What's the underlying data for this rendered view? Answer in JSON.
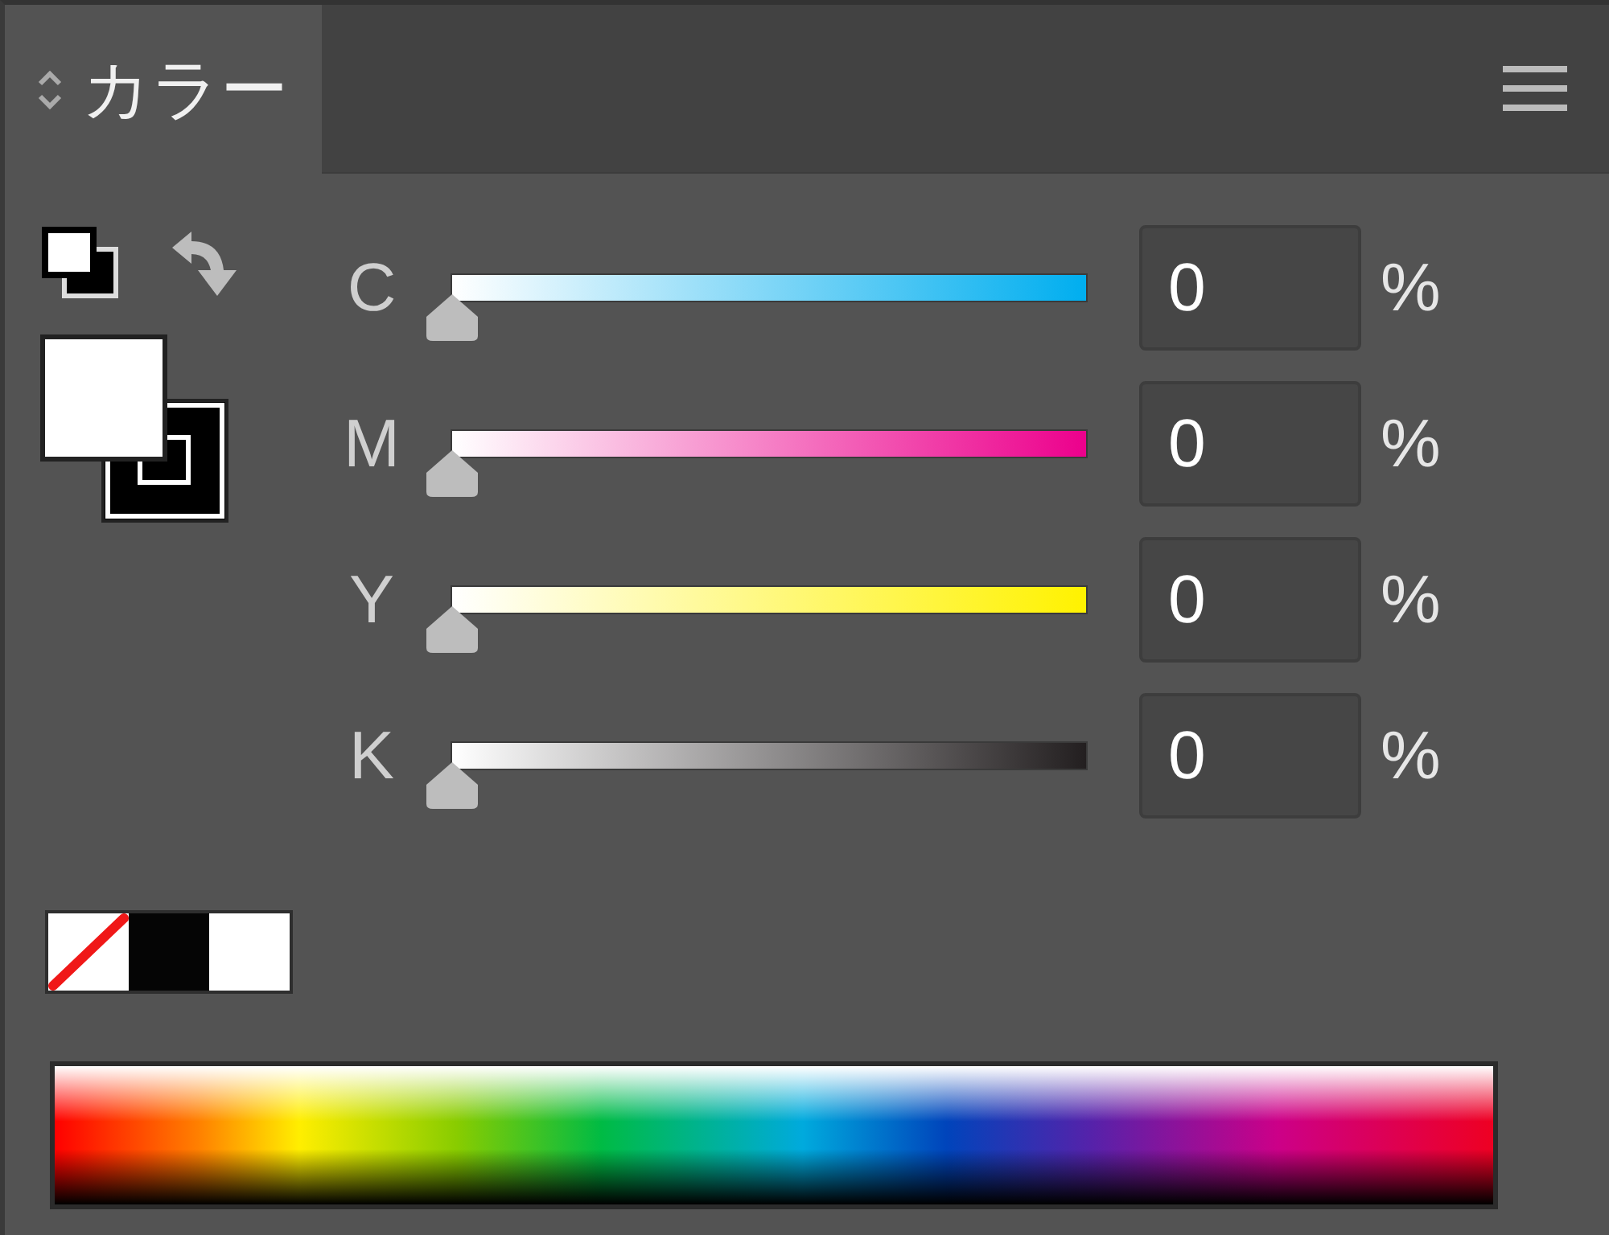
{
  "panel": {
    "tab": {
      "label": "カラー",
      "selected": true
    }
  },
  "channels": [
    {
      "name": "C",
      "color": "#00aeef",
      "level": 0,
      "value": "0",
      "unit": "%"
    },
    {
      "name": "M",
      "color": "#ec008c",
      "level": 0,
      "value": "0",
      "unit": "%"
    },
    {
      "name": "Y",
      "color": "#fff200",
      "level": 0,
      "value": "0",
      "unit": "%"
    },
    {
      "name": "K",
      "color": "#231f20",
      "level": 0,
      "value": "0",
      "unit": "%"
    }
  ],
  "swatches": [
    {
      "kind": "none"
    },
    {
      "kind": "black"
    },
    {
      "kind": "white"
    }
  ]
}
